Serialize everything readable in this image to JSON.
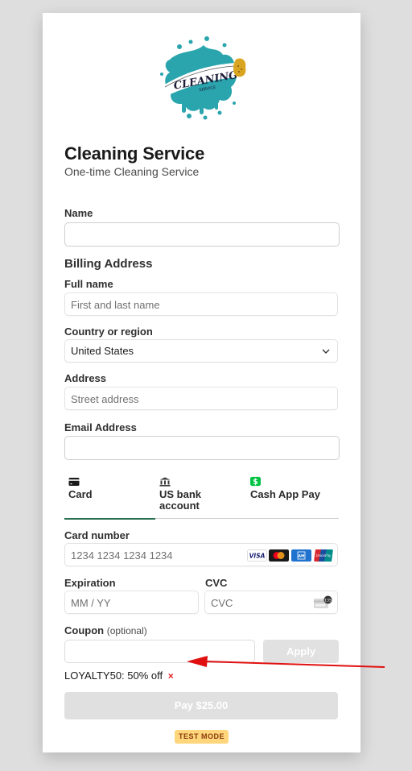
{
  "product": {
    "logo_alt": "Cleaning Service logo",
    "title": "Cleaning Service",
    "subtitle": "One-time Cleaning Service"
  },
  "form": {
    "name": {
      "label": "Name",
      "value": ""
    },
    "billing": {
      "section_title": "Billing Address",
      "full_name": {
        "label": "Full name",
        "placeholder": "First and last name"
      },
      "country": {
        "label": "Country or region",
        "value": "United States"
      },
      "address": {
        "label": "Address",
        "placeholder": "Street address"
      }
    },
    "email": {
      "label": "Email Address",
      "value": ""
    }
  },
  "payment_tabs": [
    {
      "label": "Card",
      "icon": "card-icon",
      "active": true
    },
    {
      "label": "US bank account",
      "icon": "bank-icon",
      "active": false
    },
    {
      "label": "Cash App Pay",
      "icon": "cash-app-icon",
      "active": false
    }
  ],
  "card": {
    "number": {
      "label": "Card number",
      "placeholder": "1234 1234 1234 1234"
    },
    "brands": [
      "VISA",
      "Mastercard",
      "American Express",
      "UnionPay"
    ],
    "expiration": {
      "label": "Expiration",
      "placeholder": "MM / YY"
    },
    "cvc": {
      "label": "CVC",
      "placeholder": "CVC",
      "icon_text": "135"
    }
  },
  "coupon": {
    "label": "Coupon",
    "label_suffix": "(optional)",
    "value": "",
    "apply_label": "Apply",
    "applied_text": "LOYALTY50: 50% off",
    "remove_symbol": "×"
  },
  "pay_button_label": "Pay $25.00",
  "badge": "TEST MODE",
  "colors": {
    "accent_tab": "#2a6f4f",
    "badge_bg": "#ffd67c",
    "badge_text": "#8a3a0a",
    "annotation_arrow": "#e01010",
    "logo_teal": "#2aa5ad"
  }
}
